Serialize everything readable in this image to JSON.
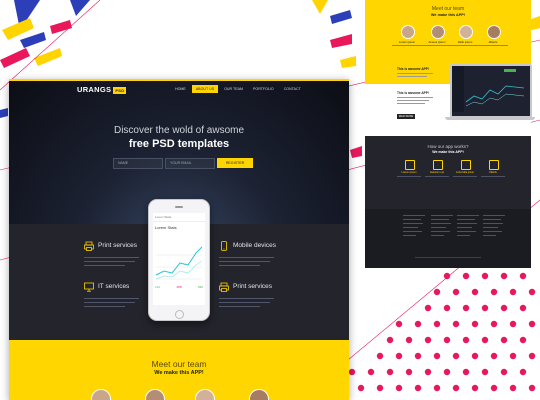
{
  "main": {
    "brand": "URANGS",
    "brand_badge": "PSD",
    "nav": [
      "HOME",
      "ABOUT US",
      "OUR TEAM",
      "PORTFOLIO",
      "CONTACT"
    ],
    "nav_active": "ABOUT US",
    "hero_title": "Discover the wold of awsome",
    "hero_title2": "free PSD templates",
    "form": {
      "name_placeholder": "NAME",
      "email_placeholder": "YOUR EMAIL",
      "register_label": "REGISTER"
    },
    "features": [
      {
        "title": "Print services",
        "icon": "printer-icon"
      },
      {
        "title": "Mobile devices",
        "icon": "mobile-icon"
      },
      {
        "title": "IT services",
        "icon": "monitor-icon"
      },
      {
        "title": "Print services",
        "icon": "printer-icon"
      }
    ],
    "phone": {
      "header": "Lorem Stats",
      "title": "Lorem Stats",
      "stats": [
        "120",
        "458",
        "520"
      ]
    },
    "team_title": "Meet our team",
    "team_subtitle": "We make this APP!"
  },
  "side": {
    "team_title": "Meet our team",
    "team_subtitle": "We make this APP!",
    "team_names": [
      "Lorem ipsum",
      "Ameoe ipsum",
      "Hello ipsum",
      "Alberts"
    ],
    "section2_headings": [
      "This is awsome APP!",
      "This is awsome APP!"
    ],
    "section2_button": "READ MORE",
    "how_title": "How our app works?",
    "how_subtitle": "We make this APP!",
    "how_labels": [
      "Lorem ipsum",
      "Awesom epr",
      "Lorla falla ipsun",
      "Ullanfu"
    ]
  },
  "colors": {
    "accent": "#ffd600",
    "dark": "#23242c",
    "pink": "#e8185b",
    "stripe_blue": "#2d3fb8"
  }
}
